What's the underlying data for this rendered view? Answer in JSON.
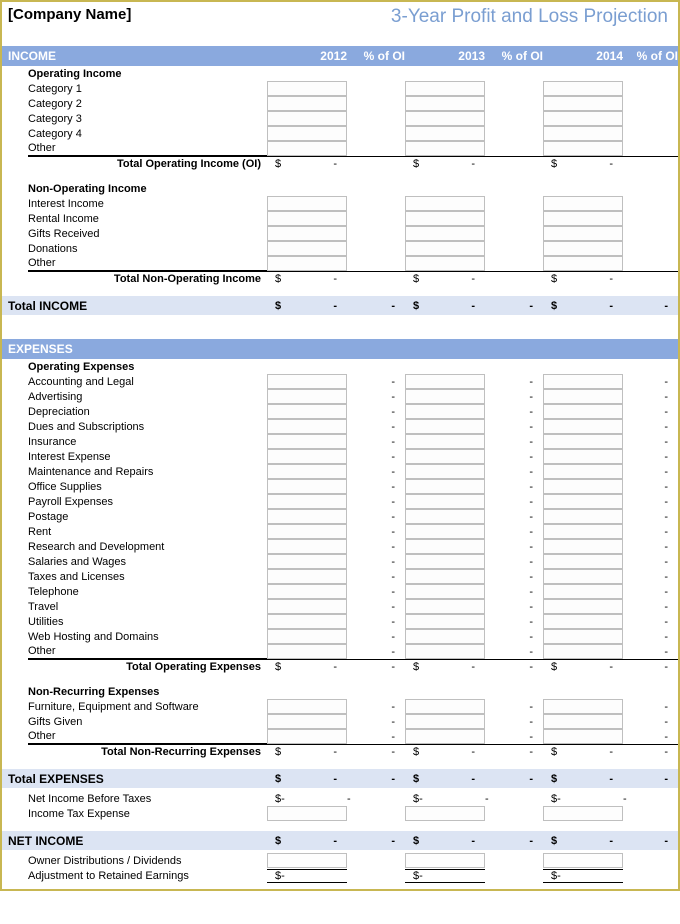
{
  "header": {
    "company": "[Company Name]",
    "title": "3-Year Profit and Loss Projection"
  },
  "years": [
    "2012",
    "2013",
    "2014"
  ],
  "pctLabel": "% of OI",
  "sections": {
    "income": "INCOME",
    "expenses": "EXPENSES"
  },
  "operatingIncome": {
    "heading": "Operating Income",
    "rows": [
      "Category 1",
      "Category 2",
      "Category 3",
      "Category 4",
      "Other"
    ],
    "total": "Total Operating Income (OI)"
  },
  "nonOperatingIncome": {
    "heading": "Non-Operating Income",
    "rows": [
      "Interest Income",
      "Rental Income",
      "Gifts Received",
      "Donations",
      "Other"
    ],
    "total": "Total Non-Operating Income"
  },
  "totalIncome": "Total INCOME",
  "operatingExpenses": {
    "heading": "Operating Expenses",
    "rows": [
      "Accounting and Legal",
      "Advertising",
      "Depreciation",
      "Dues and Subscriptions",
      "Insurance",
      "Interest Expense",
      "Maintenance and Repairs",
      "Office Supplies",
      "Payroll Expenses",
      "Postage",
      "Rent",
      "Research and Development",
      "Salaries and Wages",
      "Taxes and Licenses",
      "Telephone",
      "Travel",
      "Utilities",
      "Web Hosting and Domains",
      "Other"
    ],
    "total": "Total Operating Expenses"
  },
  "nonRecurring": {
    "heading": "Non-Recurring Expenses",
    "rows": [
      "Furniture, Equipment and Software",
      "Gifts Given",
      "Other"
    ],
    "total": "Total Non-Recurring Expenses"
  },
  "totalExpenses": "Total EXPENSES",
  "netBefore": "Net Income Before Taxes",
  "taxExp": "Income Tax Expense",
  "netIncome": "NET INCOME",
  "ownerDist": "Owner Distributions / Dividends",
  "adjust": "Adjustment to Retained Earnings",
  "dollar": "$",
  "dash": "-"
}
